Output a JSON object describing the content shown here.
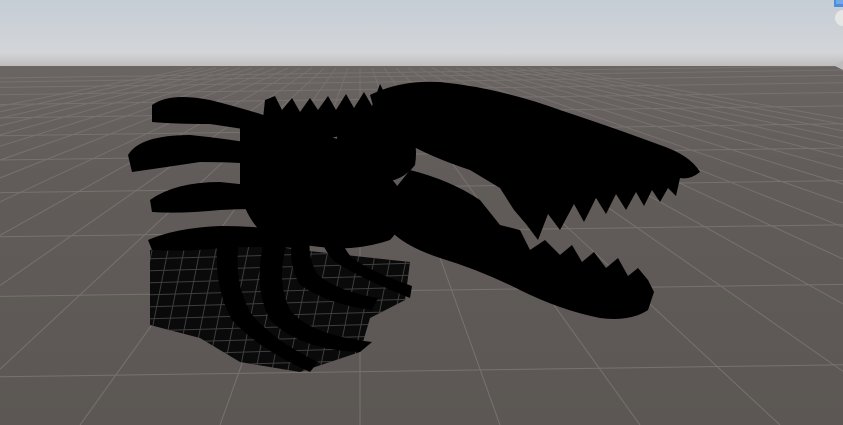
{
  "scene": {
    "sky_top_color": "#c9d0d8",
    "horizon_color": "#d2d4d7",
    "ground_color": "#5f5a57",
    "grid_line_color": "#7a7674",
    "silhouette_color": "#000000",
    "shadow_grid_color": "#4a4a4a"
  },
  "gizmo": {
    "icons": [
      "axis-y-handle-icon",
      "axis-sphere-icon",
      "axis-cone-icon"
    ],
    "accent_color": "#4a8fd8"
  }
}
